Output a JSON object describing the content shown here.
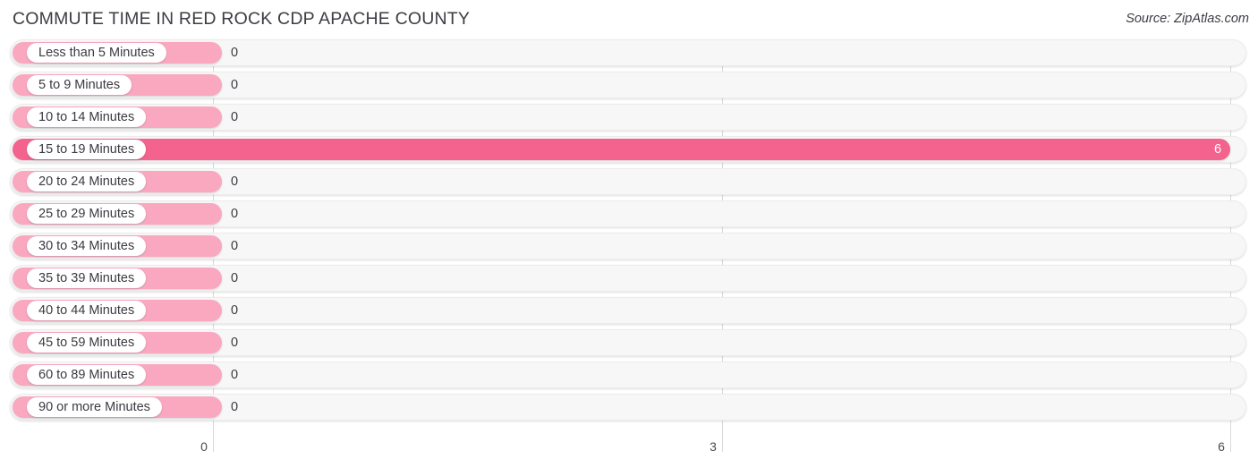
{
  "header": {
    "title": "COMMUTE TIME IN RED ROCK CDP APACHE COUNTY",
    "source": "Source: ZipAtlas.com"
  },
  "colors": {
    "bar_zero": "#f9a8c0",
    "bar_active": "#f4638e",
    "track": "#f7f7f7",
    "gridline": "#d9d9d9",
    "text": "#3a3a42"
  },
  "chart_data": {
    "type": "bar",
    "orientation": "horizontal",
    "title": "COMMUTE TIME IN RED ROCK CDP APACHE COUNTY",
    "xlabel": "",
    "ylabel": "",
    "xlim": [
      0,
      6
    ],
    "grid": true,
    "legend": null,
    "xticks": [
      "0",
      "3",
      "6"
    ],
    "xtick_values": [
      0,
      3,
      6
    ],
    "categories": [
      "Less than 5 Minutes",
      "5 to 9 Minutes",
      "10 to 14 Minutes",
      "15 to 19 Minutes",
      "20 to 24 Minutes",
      "25 to 29 Minutes",
      "30 to 34 Minutes",
      "35 to 39 Minutes",
      "40 to 44 Minutes",
      "45 to 59 Minutes",
      "60 to 89 Minutes",
      "90 or more Minutes"
    ],
    "values": [
      0,
      0,
      0,
      6,
      0,
      0,
      0,
      0,
      0,
      0,
      0,
      0
    ],
    "value_labels": [
      "0",
      "0",
      "0",
      "6",
      "0",
      "0",
      "0",
      "0",
      "0",
      "0",
      "0",
      "0"
    ]
  },
  "rows": [
    {
      "label": "Less than 5 Minutes",
      "value": 0,
      "value_label": "0",
      "highlight": false
    },
    {
      "label": "5 to 9 Minutes",
      "value": 0,
      "value_label": "0",
      "highlight": false
    },
    {
      "label": "10 to 14 Minutes",
      "value": 0,
      "value_label": "0",
      "highlight": false
    },
    {
      "label": "15 to 19 Minutes",
      "value": 6,
      "value_label": "6",
      "highlight": true
    },
    {
      "label": "20 to 24 Minutes",
      "value": 0,
      "value_label": "0",
      "highlight": false
    },
    {
      "label": "25 to 29 Minutes",
      "value": 0,
      "value_label": "0",
      "highlight": false
    },
    {
      "label": "30 to 34 Minutes",
      "value": 0,
      "value_label": "0",
      "highlight": false
    },
    {
      "label": "35 to 39 Minutes",
      "value": 0,
      "value_label": "0",
      "highlight": false
    },
    {
      "label": "40 to 44 Minutes",
      "value": 0,
      "value_label": "0",
      "highlight": false
    },
    {
      "label": "45 to 59 Minutes",
      "value": 0,
      "value_label": "0",
      "highlight": false
    },
    {
      "label": "60 to 89 Minutes",
      "value": 0,
      "value_label": "0",
      "highlight": false
    },
    {
      "label": "90 or more Minutes",
      "value": 0,
      "value_label": "0",
      "highlight": false
    }
  ],
  "axis": {
    "ticks": [
      {
        "label": "0",
        "value": 0
      },
      {
        "label": "3",
        "value": 3
      },
      {
        "label": "6",
        "value": 6
      }
    ]
  }
}
